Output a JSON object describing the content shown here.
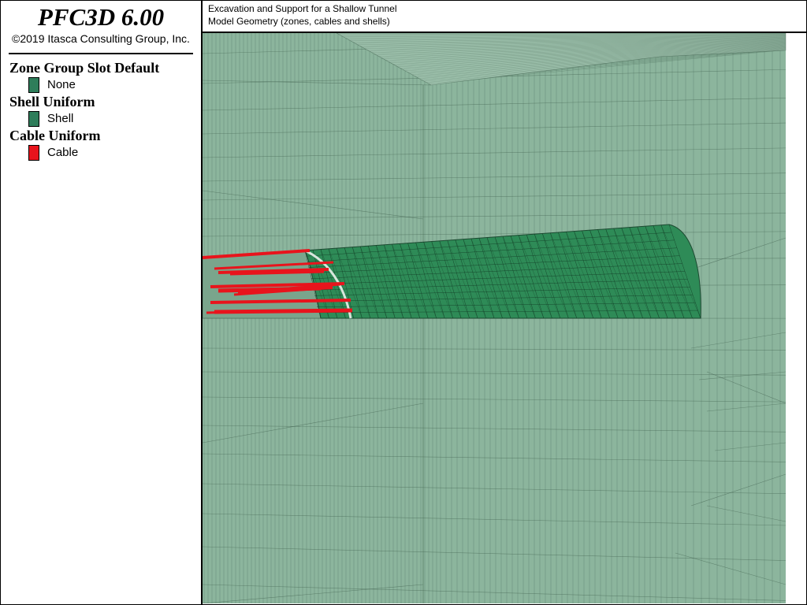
{
  "app": {
    "title": "PFC3D 6.00",
    "copyright": "©2019 Itasca Consulting Group, Inc."
  },
  "legend": {
    "groups": [
      {
        "heading": "Zone Group Slot Default",
        "item": "None",
        "color": "#2e7d5a"
      },
      {
        "heading": "Shell Uniform",
        "item": "Shell",
        "color": "#2e7d5a"
      },
      {
        "heading": "Cable Uniform",
        "item": "Cable",
        "color": "#e8141c"
      }
    ]
  },
  "plot": {
    "title_lines": [
      "Excavation and Support for a Shallow Tunnel",
      "Model Geometry (zones, cables and shells)"
    ]
  },
  "colors": {
    "zone_fill": "#8cb59d",
    "shell_fill": "#2e8b57",
    "cable": "#e8141c",
    "mesh_line": "#3a5a48"
  }
}
